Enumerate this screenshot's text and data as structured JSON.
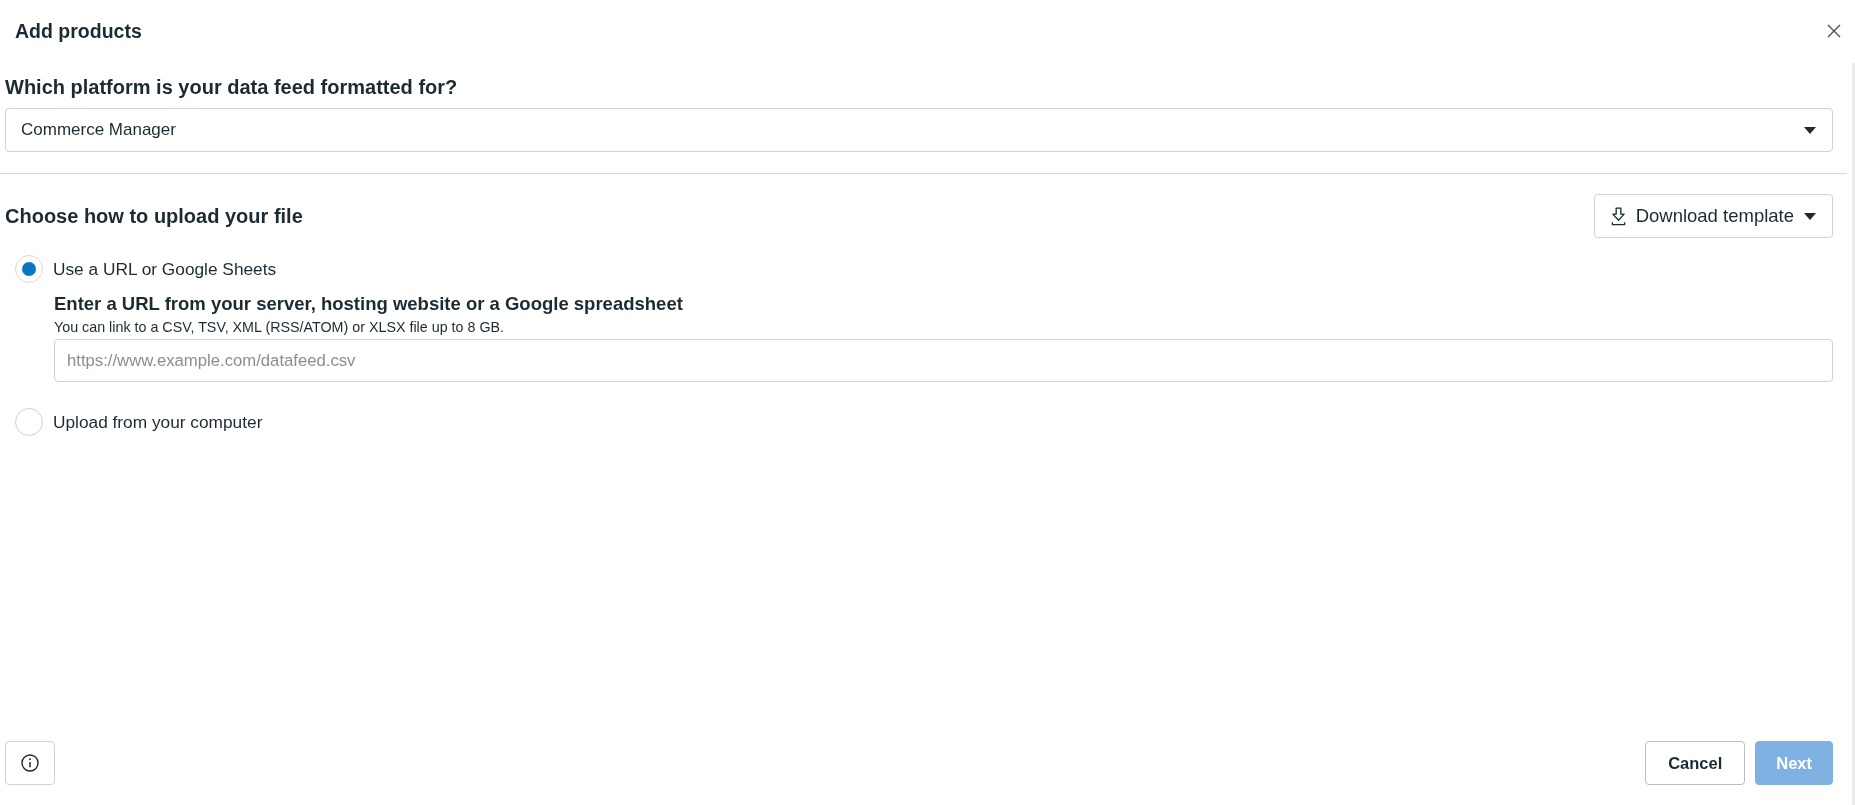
{
  "dialog": {
    "title": "Add products"
  },
  "platform": {
    "label": "Which platform is your data feed formatted for?",
    "value": "Commerce Manager"
  },
  "upload": {
    "heading": "Choose how to upload your file",
    "download_button": "Download template",
    "options": [
      {
        "label": "Use a URL or Google Sheets",
        "selected": true,
        "heading": "Enter a URL from your server, hosting website or a Google spreadsheet",
        "hint": "You can link to a CSV, TSV, XML (RSS/ATOM) or XLSX file up to 8 GB.",
        "placeholder": "https://www.example.com/datafeed.csv"
      },
      {
        "label": "Upload from your computer",
        "selected": false
      }
    ]
  },
  "footer": {
    "buttons": [
      {
        "label": "Cancel",
        "kind": "secondary",
        "disabled": false
      },
      {
        "label": "Next",
        "kind": "primary",
        "disabled": true
      }
    ]
  }
}
